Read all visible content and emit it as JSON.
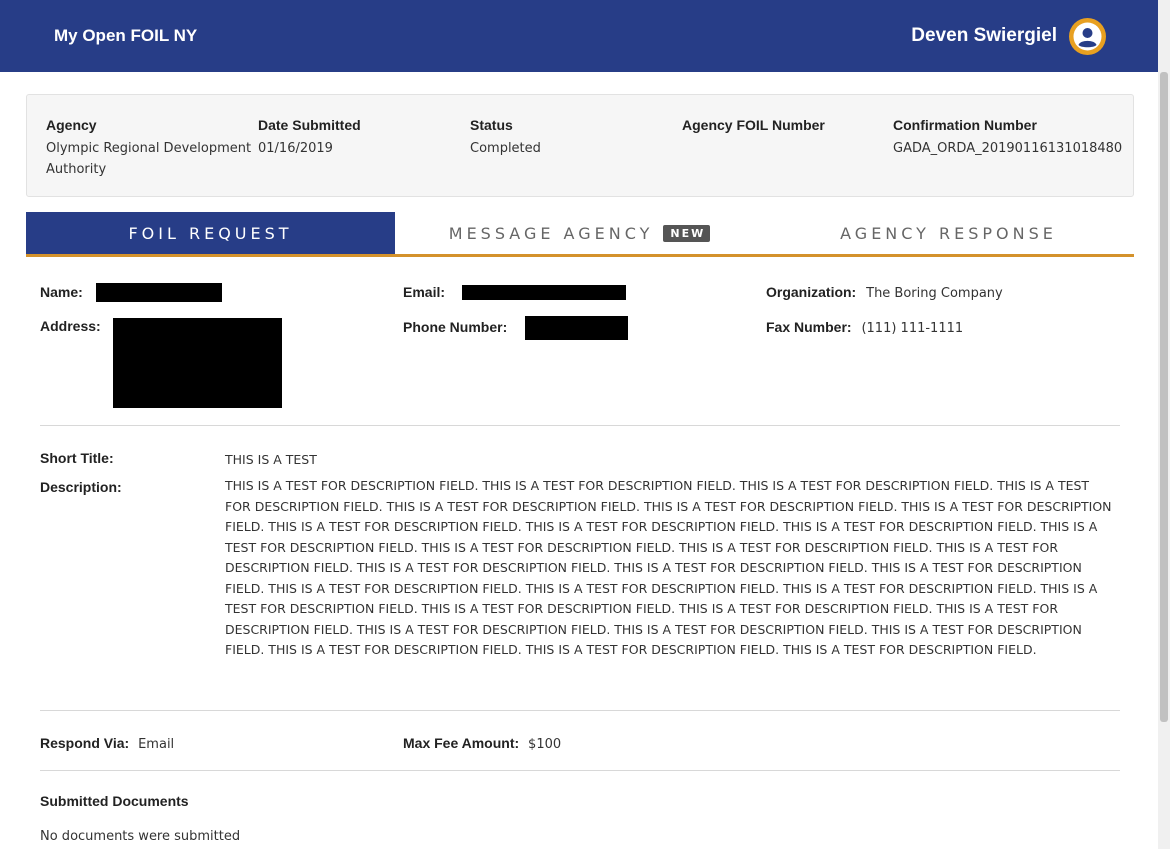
{
  "header": {
    "app_title": "My Open FOIL NY",
    "user_name": "Deven Swiergiel",
    "user_icon": "user-circle-icon",
    "bg_color": "#273d87",
    "accent_color": "#e8a020"
  },
  "summary": {
    "agency_label": "Agency",
    "agency_value": "Olympic Regional Development Authority",
    "date_label": "Date Submitted",
    "date_value": "01/16/2019",
    "status_label": "Status",
    "status_value": "Completed",
    "foil_number_label": "Agency FOIL Number",
    "foil_number_value": "",
    "confirmation_label": "Confirmation Number",
    "confirmation_value": "GADA_ORDA_20190116131018480"
  },
  "tabs": [
    {
      "label": "FOIL REQUEST",
      "active": true
    },
    {
      "label": "MESSAGE AGENCY",
      "badge": "NEW",
      "active": false
    },
    {
      "label": "AGENCY RESPONSE",
      "active": false
    }
  ],
  "requester": {
    "name_label": "Name:",
    "email_label": "Email:",
    "organization_label": "Organization:",
    "organization_value": "The Boring Company",
    "address_label": "Address:",
    "phone_label": "Phone Number:",
    "fax_label": "Fax Number:",
    "fax_value": "(111) 111-1111"
  },
  "request": {
    "short_title_label": "Short Title:",
    "short_title_value": "THIS IS A TEST",
    "description_label": "Description:",
    "description_value": "THIS IS A TEST FOR DESCRIPTION FIELD. THIS IS A TEST FOR DESCRIPTION FIELD. THIS IS A TEST FOR DESCRIPTION FIELD. THIS IS A TEST FOR DESCRIPTION FIELD. THIS IS A TEST FOR DESCRIPTION FIELD. THIS IS A TEST FOR DESCRIPTION FIELD. THIS IS A TEST FOR DESCRIPTION FIELD. THIS IS A TEST FOR DESCRIPTION FIELD. THIS IS A TEST FOR DESCRIPTION FIELD. THIS IS A TEST FOR DESCRIPTION FIELD. THIS IS A TEST FOR DESCRIPTION FIELD. THIS IS A TEST FOR DESCRIPTION FIELD. THIS IS A TEST FOR DESCRIPTION FIELD. THIS IS A TEST FOR DESCRIPTION FIELD. THIS IS A TEST FOR DESCRIPTION FIELD. THIS IS A TEST FOR DESCRIPTION FIELD. THIS IS A TEST FOR DESCRIPTION FIELD. THIS IS A TEST FOR DESCRIPTION FIELD. THIS IS A TEST FOR DESCRIPTION FIELD. THIS IS A TEST FOR DESCRIPTION FIELD. THIS IS A TEST FOR DESCRIPTION FIELD. THIS IS A TEST FOR DESCRIPTION FIELD. THIS IS A TEST FOR DESCRIPTION FIELD. THIS IS A TEST FOR DESCRIPTION FIELD. THIS IS A TEST FOR DESCRIPTION FIELD. THIS IS A TEST FOR DESCRIPTION FIELD. THIS IS A TEST FOR DESCRIPTION FIELD. THIS IS A TEST FOR DESCRIPTION FIELD. THIS IS A TEST FOR DESCRIPTION FIELD. THIS IS A TEST FOR DESCRIPTION FIELD."
  },
  "delivery": {
    "respond_label": "Respond Via:",
    "respond_value": "Email",
    "fee_label": "Max Fee Amount:",
    "fee_value": "$100"
  },
  "documents": {
    "title": "Submitted Documents",
    "empty_text": "No documents were submitted"
  }
}
